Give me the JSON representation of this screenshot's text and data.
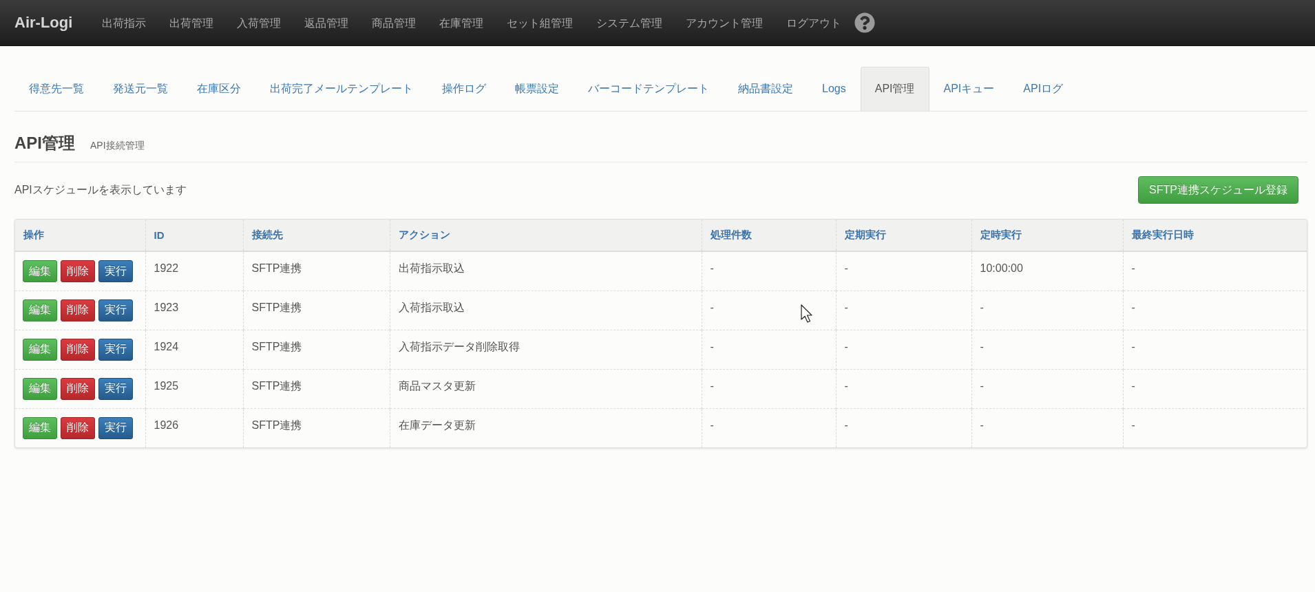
{
  "navbar": {
    "brand": "Air-Logi",
    "links": [
      "出荷指示",
      "出荷管理",
      "入荷管理",
      "返品管理",
      "商品管理",
      "在庫管理",
      "セット組管理",
      "システム管理",
      "アカウント管理",
      "ログアウト"
    ]
  },
  "tabs": [
    {
      "label": "得意先一覧",
      "selected": false
    },
    {
      "label": "発送元一覧",
      "selected": false
    },
    {
      "label": "在庫区分",
      "selected": false
    },
    {
      "label": "出荷完了メールテンプレート",
      "selected": false
    },
    {
      "label": "操作ログ",
      "selected": false
    },
    {
      "label": "帳票設定",
      "selected": false
    },
    {
      "label": "バーコードテンプレート",
      "selected": false
    },
    {
      "label": "納品書設定",
      "selected": false
    },
    {
      "label": "Logs",
      "selected": false
    },
    {
      "label": "API管理",
      "selected": true
    },
    {
      "label": "APIキュー",
      "selected": false
    },
    {
      "label": "APIログ",
      "selected": false
    }
  ],
  "page_header": {
    "title": "API管理",
    "subtitle": "API接続管理"
  },
  "toolbar": {
    "message": "APIスケジュールを表示しています",
    "button": "SFTP連携スケジュール登録"
  },
  "table": {
    "columns": [
      "操作",
      "ID",
      "接続先",
      "アクション",
      "処理件数",
      "定期実行",
      "定時実行",
      "最終実行日時"
    ],
    "rows": [
      {
        "cells": [
          {
            "buttons": [
              {
                "kind": "edit",
                "label": "編集"
              },
              {
                "kind": "delete",
                "label": "削除"
              },
              {
                "kind": "run",
                "label": "実行"
              }
            ]
          },
          "1922",
          "SFTP連携",
          "出荷指示取込",
          "-",
          "-",
          "10:00:00",
          "-"
        ]
      },
      {
        "cells": [
          {
            "buttons": [
              {
                "kind": "edit",
                "label": "編集"
              },
              {
                "kind": "delete",
                "label": "削除"
              },
              {
                "kind": "run",
                "label": "実行"
              }
            ]
          },
          "1923",
          "SFTP連携",
          "入荷指示取込",
          "-",
          "-",
          "-",
          "-"
        ]
      },
      {
        "cells": [
          {
            "buttons": [
              {
                "kind": "edit",
                "label": "編集"
              },
              {
                "kind": "delete",
                "label": "削除"
              },
              {
                "kind": "run",
                "label": "実行"
              }
            ]
          },
          "1924",
          "SFTP連携",
          "入荷指示データ削除取得",
          "-",
          "-",
          "-",
          "-"
        ]
      },
      {
        "cells": [
          {
            "buttons": [
              {
                "kind": "edit",
                "label": "編集"
              },
              {
                "kind": "delete",
                "label": "削除"
              },
              {
                "kind": "run",
                "label": "実行"
              }
            ]
          },
          "1925",
          "SFTP連携",
          "商品マスタ更新",
          "-",
          "-",
          "-",
          "-"
        ]
      },
      {
        "cells": [
          {
            "buttons": [
              {
                "kind": "edit",
                "label": "編集"
              },
              {
                "kind": "delete",
                "label": "削除"
              },
              {
                "kind": "run",
                "label": "実行"
              }
            ]
          },
          "1926",
          "SFTP連携",
          "在庫データ更新",
          "-",
          "-",
          "-",
          "-"
        ]
      }
    ]
  }
}
